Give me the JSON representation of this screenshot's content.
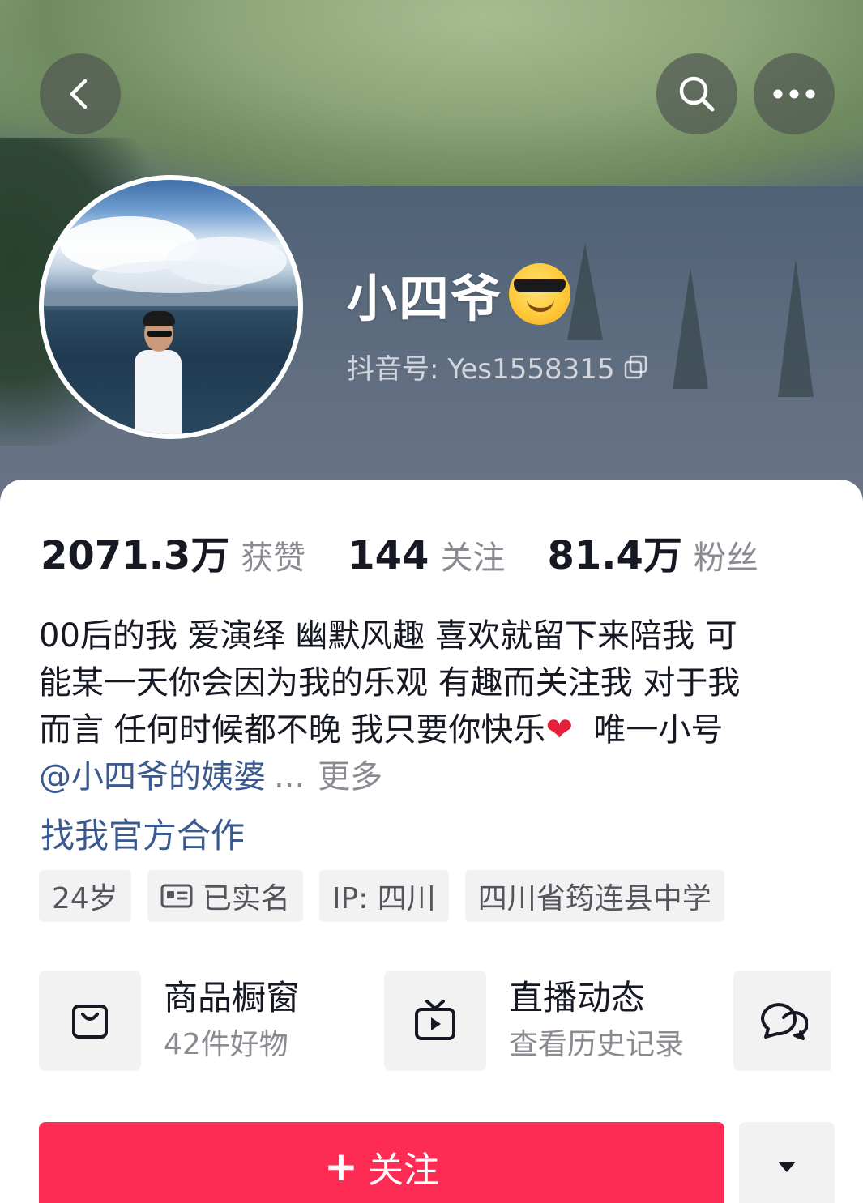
{
  "header": {
    "nickname": "小四爷",
    "douyin_id_label": "抖音号: Yes1558315"
  },
  "stats": [
    {
      "value": "2071.3万",
      "label": "获赞"
    },
    {
      "value": "144",
      "label": "关注"
    },
    {
      "value": "81.4万",
      "label": "粉丝"
    }
  ],
  "bio": {
    "line1": "00后的我 爱演绎 幽默风趣 喜欢就留下来陪我  可",
    "line2": "能某一天你会因为我的乐观 有趣而关注我   对于我",
    "line3_text": "而言 任何时候都不晚 我只要你快乐",
    "line3_heart": "❤",
    "line3_tail": "  唯一小号",
    "mention": "@小四爷的姨婆",
    "ellipsis": "...",
    "more": "更多"
  },
  "cooperation": "找我官方合作",
  "tags": {
    "age": "24岁",
    "verified": "已实名",
    "ip": "IP: 四川",
    "school": "四川省筠连县中学"
  },
  "entries": [
    {
      "title": "商品橱窗",
      "subtitle": "42件好物",
      "icon": "shopping-bag-icon"
    },
    {
      "title": "直播动态",
      "subtitle": "查看历史记录",
      "icon": "tv-play-icon"
    }
  ],
  "actions": {
    "follow_plus": "+",
    "follow_label": "关注"
  },
  "colors": {
    "accent": "#fe2c55",
    "link": "#3a5a8f",
    "secondary_text": "#8a8b91",
    "chip_bg": "#f2f2f3"
  }
}
